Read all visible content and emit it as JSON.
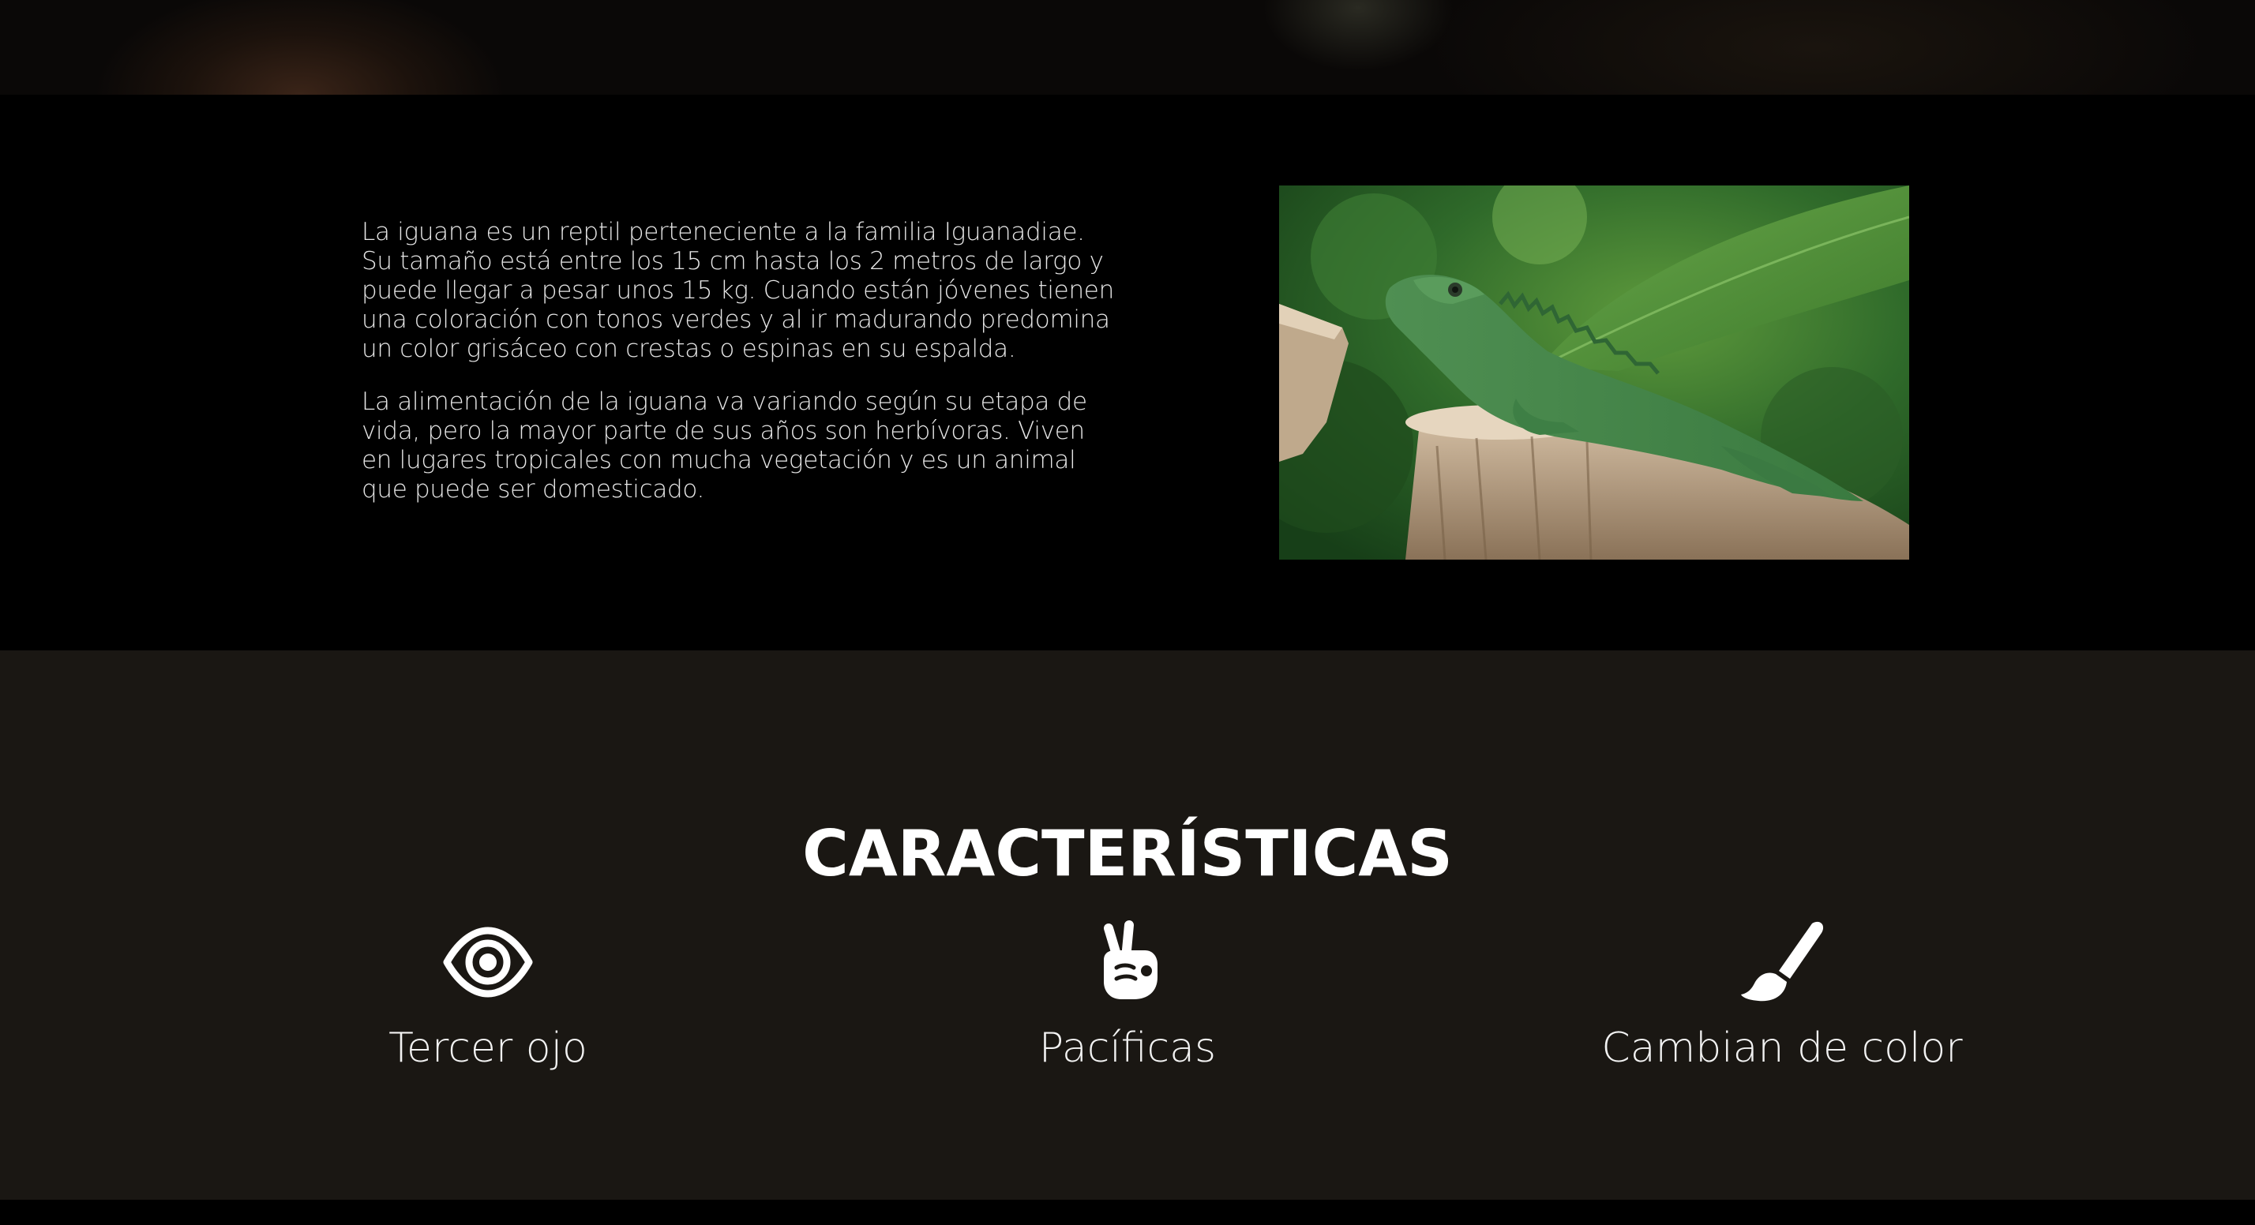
{
  "intro": {
    "paragraphs": [
      "La iguana es un reptil perteneciente a la familia Iguanadiae. Su tamaño está entre los 15 cm hasta los 2 metros de largo y puede llegar a pesar unos 15 kg. Cuando están jóvenes tienen una coloración con tonos verdes y al ir madurando predomina un color grisáceo con crestas o espinas en su espalda.",
      "La alimentación de la iguana va variando según su etapa de vida, pero la mayor parte de sus años son herbívoras. Viven en lugares tropicales con mucha vegetación y es un animal que puede ser domesticado."
    ]
  },
  "features": {
    "title": "CARACTERÍSTICAS",
    "items": [
      {
        "icon": "eye-icon",
        "label": "Tercer ojo"
      },
      {
        "icon": "peace-hand-icon",
        "label": "Pacíficas"
      },
      {
        "icon": "paint-brush-icon",
        "label": "Cambian de color"
      }
    ]
  },
  "colors": {
    "page_background": "#000000",
    "features_background": "#1a1713",
    "text": "#e6e6e6",
    "heading": "#ffffff"
  }
}
